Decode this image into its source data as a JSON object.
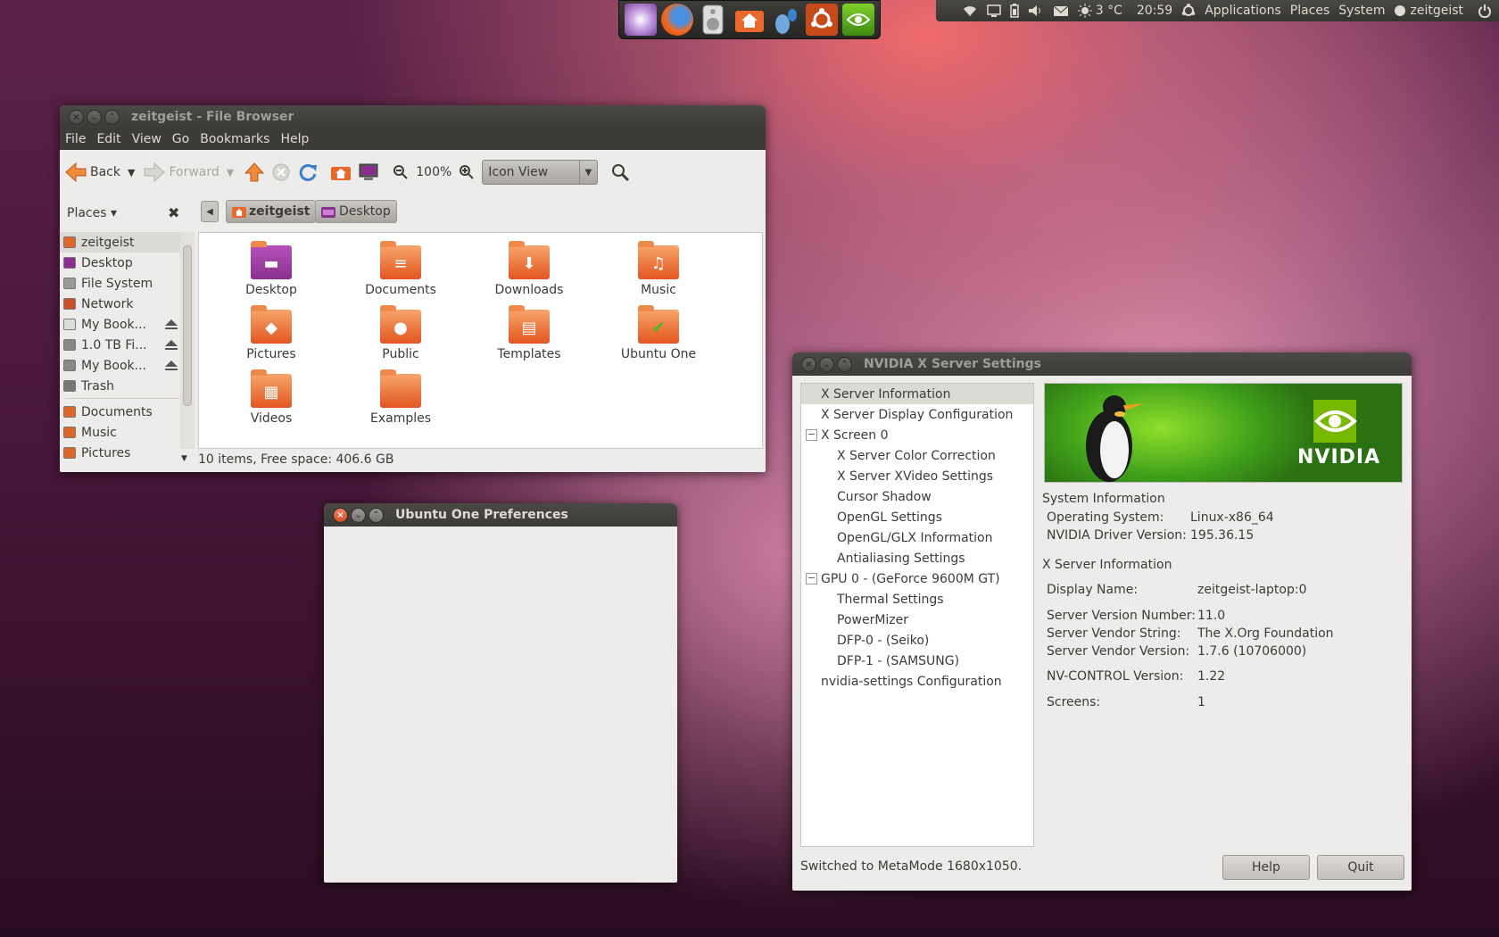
{
  "panel": {
    "temperature": "3 °C",
    "clock": "20:59",
    "menus": [
      "Applications",
      "Places",
      "System"
    ],
    "user": "zeitgeist"
  },
  "dock": {
    "icons": [
      "settings-burst-icon",
      "firefox-icon",
      "speaker-icon",
      "home-folder-icon",
      "gnome-feet-icon",
      "ubuntu-weather-icon",
      "nvidia-icon"
    ]
  },
  "file_browser": {
    "title": "zeitgeist - File Browser",
    "menu": [
      "File",
      "Edit",
      "View",
      "Go",
      "Bookmarks",
      "Help"
    ],
    "toolbar": {
      "back": "Back",
      "forward": "Forward",
      "zoom": "100%",
      "view_mode": "Icon View"
    },
    "places_label": "Places",
    "breadcrumb": [
      "zeitgeist",
      "Desktop"
    ],
    "sidebar": [
      {
        "label": "zeitgeist",
        "icon": "home-icon",
        "color": "#e0652a",
        "eject": false
      },
      {
        "label": "Desktop",
        "icon": "desktop-icon",
        "color": "#8a2f8f",
        "eject": false
      },
      {
        "label": "File System",
        "icon": "harddisk-icon",
        "color": "#999999",
        "eject": false
      },
      {
        "label": "Network",
        "icon": "network-icon",
        "color": "#c8502a",
        "eject": false
      },
      {
        "label": "My Book...",
        "icon": "drive-icon",
        "color": "#dddddd",
        "eject": true
      },
      {
        "label": "1.0 TB Fi...",
        "icon": "usb-icon",
        "color": "#888888",
        "eject": true
      },
      {
        "label": "My Book...",
        "icon": "usb-icon",
        "color": "#888888",
        "eject": true
      },
      {
        "label": "Trash",
        "icon": "trash-icon",
        "color": "#777777",
        "eject": false
      },
      {
        "label": "Documents",
        "icon": "folder-icon",
        "color": "#e0652a",
        "eject": false
      },
      {
        "label": "Music",
        "icon": "folder-icon",
        "color": "#e0652a",
        "eject": false
      },
      {
        "label": "Pictures",
        "icon": "folder-icon",
        "color": "#e0652a",
        "eject": false
      }
    ],
    "items": [
      {
        "label": "Desktop",
        "glyph": "▬",
        "color": "#8a2f8f"
      },
      {
        "label": "Documents",
        "glyph": "≡",
        "color": "#e1561f"
      },
      {
        "label": "Downloads",
        "glyph": "⬇",
        "color": "#e1561f"
      },
      {
        "label": "Music",
        "glyph": "♫",
        "color": "#e1561f"
      },
      {
        "label": "Pictures",
        "glyph": "◆",
        "color": "#e1561f"
      },
      {
        "label": "Public",
        "glyph": "●",
        "color": "#e1561f"
      },
      {
        "label": "Templates",
        "glyph": "▤",
        "color": "#e1561f"
      },
      {
        "label": "Ubuntu One",
        "glyph": "✔",
        "color": "#e1561f"
      },
      {
        "label": "Videos",
        "glyph": "▦",
        "color": "#e1561f"
      },
      {
        "label": "Examples",
        "glyph": "",
        "color": "#e1561f"
      }
    ],
    "status": "10 items, Free space: 406.6 GB"
  },
  "ubuntu_one": {
    "title": "Ubuntu One Preferences"
  },
  "nvidia": {
    "title": "NVIDIA X Server Settings",
    "tree": [
      {
        "label": "X Server Information",
        "level": 0,
        "selected": true,
        "expander": ""
      },
      {
        "label": "X Server Display Configuration",
        "level": 0,
        "selected": false,
        "expander": ""
      },
      {
        "label": "X Screen 0",
        "level": 0,
        "selected": false,
        "expander": "−"
      },
      {
        "label": "X Server Color Correction",
        "level": 1,
        "selected": false,
        "expander": ""
      },
      {
        "label": "X Server XVideo Settings",
        "level": 1,
        "selected": false,
        "expander": ""
      },
      {
        "label": "Cursor Shadow",
        "level": 1,
        "selected": false,
        "expander": ""
      },
      {
        "label": "OpenGL Settings",
        "level": 1,
        "selected": false,
        "expander": ""
      },
      {
        "label": "OpenGL/GLX Information",
        "level": 1,
        "selected": false,
        "expander": ""
      },
      {
        "label": "Antialiasing Settings",
        "level": 1,
        "selected": false,
        "expander": ""
      },
      {
        "label": "GPU 0 - (GeForce 9600M GT)",
        "level": 0,
        "selected": false,
        "expander": "−"
      },
      {
        "label": "Thermal Settings",
        "level": 1,
        "selected": false,
        "expander": ""
      },
      {
        "label": "PowerMizer",
        "level": 1,
        "selected": false,
        "expander": ""
      },
      {
        "label": "DFP-0 - (Seiko)",
        "level": 1,
        "selected": false,
        "expander": ""
      },
      {
        "label": "DFP-1 - (SAMSUNG)",
        "level": 1,
        "selected": false,
        "expander": ""
      },
      {
        "label": "nvidia-settings Configuration",
        "level": 0,
        "selected": false,
        "expander": ""
      }
    ],
    "brand": "NVIDIA",
    "system_info_heading": "System Information",
    "system_info": [
      {
        "label": "Operating System:",
        "value": "Linux-x86_64"
      },
      {
        "label": "NVIDIA Driver Version:",
        "value": "195.36.15"
      }
    ],
    "xserver_heading": "X Server Information",
    "xserver_info": [
      {
        "label": "Display Name:",
        "value": "zeitgeist-laptop:0"
      },
      {
        "label": "Server Version Number:",
        "value": "11.0"
      },
      {
        "label": "Server Vendor String:",
        "value": "The X.Org Foundation"
      },
      {
        "label": "Server Vendor Version:",
        "value": "1.7.6 (10706000)"
      },
      {
        "label": "NV-CONTROL Version:",
        "value": "1.22"
      },
      {
        "label": "Screens:",
        "value": "1"
      }
    ],
    "status": "Switched to MetaMode 1680x1050.",
    "help_button": "Help",
    "quit_button": "Quit"
  }
}
